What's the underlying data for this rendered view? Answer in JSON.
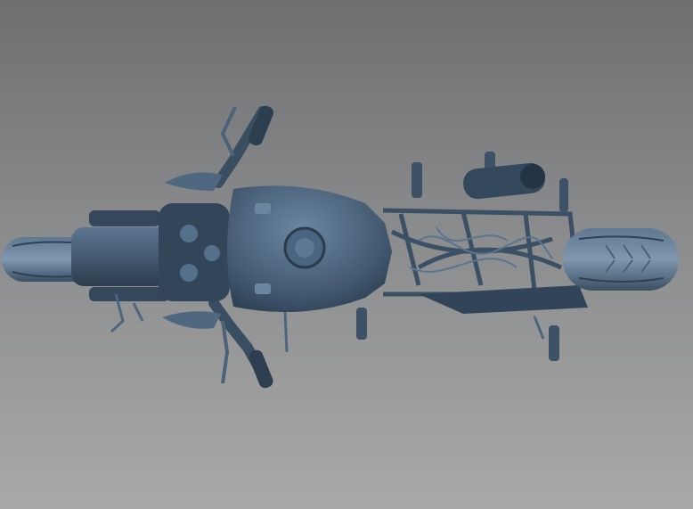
{
  "scene": {
    "subject_icon": "motorcycle-top-view-3d-scan",
    "colors": {
      "background_top": "#6e6f71",
      "background_bottom": "#a9a9a9",
      "model_base": "#3f556b",
      "model_highlight": "#7f98b0",
      "model_shadow": "#1f2d3a"
    }
  }
}
